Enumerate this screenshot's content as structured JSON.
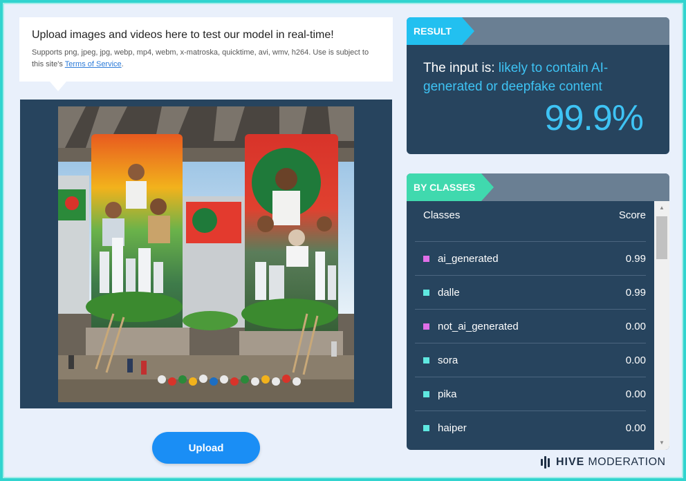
{
  "upload_info": {
    "title": "Upload images and videos here to test our model in real-time!",
    "supports_text": "Supports png, jpeg, jpg, webp, mp4, webm, x-matroska, quicktime, avi, wmv, h264. Use is subject to this site's ",
    "terms_link": "Terms of Service",
    "after_link": "."
  },
  "upload_button": {
    "label": "Upload"
  },
  "result": {
    "header": "RESULT",
    "prefix": "The input is: ",
    "verdict": "likely to contain AI-generated or deepfake content",
    "score": "99.9%"
  },
  "classes": {
    "header": "BY CLASSES",
    "col_classes": "Classes",
    "col_score": "Score",
    "rows": [
      {
        "name": "ai_generated",
        "score": "0.99",
        "color": "#e06fe8"
      },
      {
        "name": "dalle",
        "score": "0.99",
        "color": "#5fe8e0"
      },
      {
        "name": "not_ai_generated",
        "score": "0.00",
        "color": "#e06fe8"
      },
      {
        "name": "sora",
        "score": "0.00",
        "color": "#5fe8e0"
      },
      {
        "name": "pika",
        "score": "0.00",
        "color": "#5fe8e0"
      },
      {
        "name": "haiper",
        "score": "0.00",
        "color": "#5fe8e0"
      }
    ]
  },
  "brand": {
    "bold": "HIVE",
    "rest": "MODERATION"
  },
  "colors": {
    "accent_blue": "#22c0f0",
    "accent_green": "#40d9ae",
    "panel_dark": "#27445e",
    "button_blue": "#1a8ef5"
  }
}
